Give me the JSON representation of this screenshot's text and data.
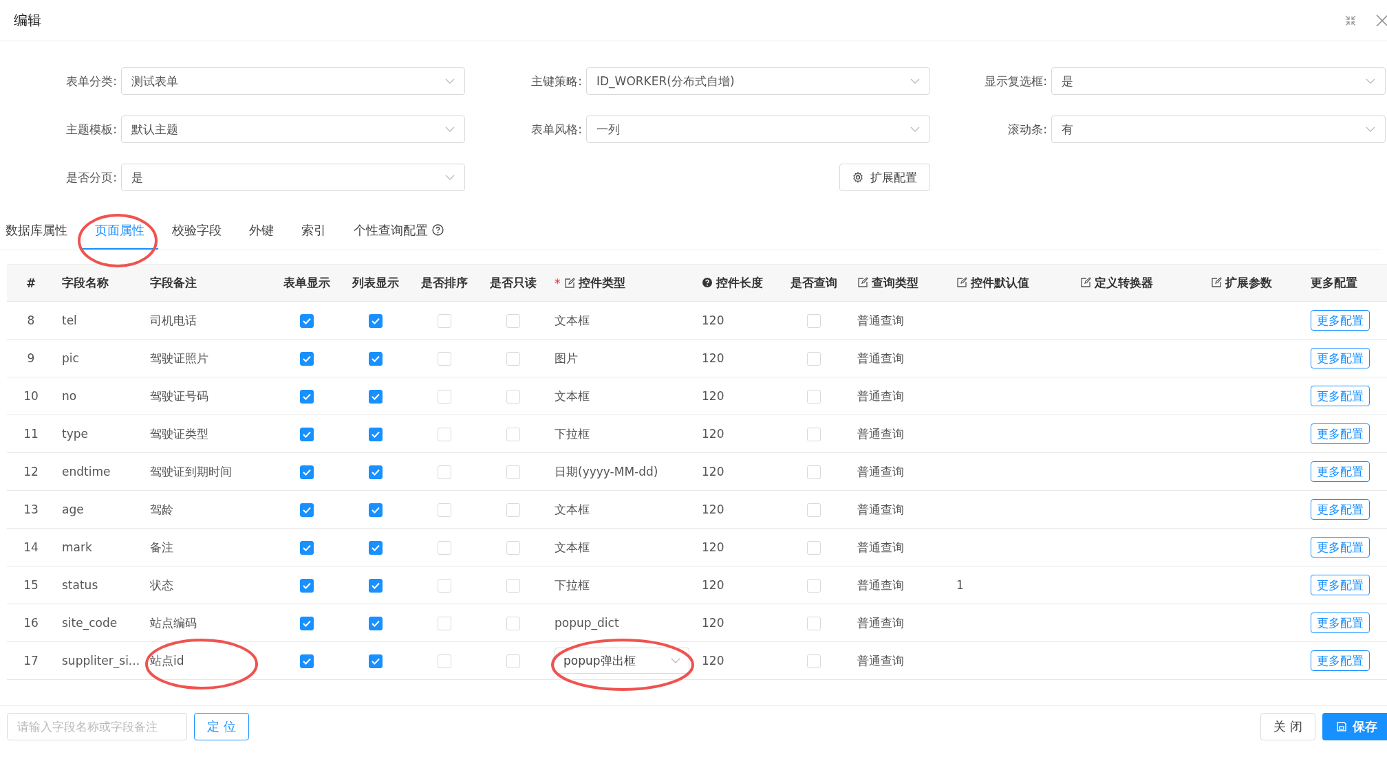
{
  "window": {
    "title": "编辑"
  },
  "form_fields": [
    {
      "label": "表单分类:",
      "value": "测试表单"
    },
    {
      "label": "主键策略:",
      "value": "ID_WORKER(分布式自增)"
    },
    {
      "label": "显示复选框:",
      "value": "是"
    },
    {
      "label": "主题模板:",
      "value": "默认主题"
    },
    {
      "label": "表单风格:",
      "value": "一列"
    },
    {
      "label": "滚动条:",
      "value": "有"
    },
    {
      "label": "是否分页:",
      "value": "是"
    }
  ],
  "extension_button": "扩展配置",
  "tabs": [
    {
      "label": "数据库属性",
      "selected": false
    },
    {
      "label": "页面属性",
      "selected": true
    },
    {
      "label": "校验字段",
      "selected": false
    },
    {
      "label": "外键",
      "selected": false
    },
    {
      "label": "索引",
      "selected": false
    },
    {
      "label": "个性查询配置",
      "selected": false,
      "help": true
    }
  ],
  "table": {
    "columns": [
      {
        "label": "#"
      },
      {
        "label": "字段名称"
      },
      {
        "label": "字段备注"
      },
      {
        "label": "表单显示"
      },
      {
        "label": "列表显示"
      },
      {
        "label": "是否排序"
      },
      {
        "label": "是否只读"
      },
      {
        "label": "控件类型",
        "required_mark": "*",
        "kind": "editable"
      },
      {
        "label": "控件长度",
        "kind": "help"
      },
      {
        "label": "是否查询"
      },
      {
        "label": "查询类型",
        "kind": "editable"
      },
      {
        "label": "控件默认值",
        "kind": "editable"
      },
      {
        "label": "定义转换器",
        "kind": "editable"
      },
      {
        "label": "扩展参数",
        "kind": "editable"
      },
      {
        "label": "更多配置"
      }
    ],
    "rows": [
      {
        "index": "8",
        "name": "tel",
        "note": "司机电话",
        "form_show": true,
        "list_show": true,
        "sortable": false,
        "readonly": false,
        "control_type": {
          "kind": "text",
          "value": "文本框"
        },
        "length": "120",
        "query": false,
        "query_type": "普通查询",
        "action": "更多配置"
      },
      {
        "index": "9",
        "name": "pic",
        "note": "驾驶证照片",
        "form_show": true,
        "list_show": true,
        "sortable": false,
        "readonly": false,
        "control_type": {
          "kind": "text",
          "value": "图片"
        },
        "length": "120",
        "query": false,
        "query_type": "普通查询",
        "action": "更多配置"
      },
      {
        "index": "10",
        "name": "no",
        "note": "驾驶证号码",
        "form_show": true,
        "list_show": true,
        "sortable": false,
        "readonly": false,
        "control_type": {
          "kind": "text",
          "value": "文本框"
        },
        "length": "120",
        "query": false,
        "query_type": "普通查询",
        "action": "更多配置"
      },
      {
        "index": "11",
        "name": "type",
        "note": "驾驶证类型",
        "form_show": true,
        "list_show": true,
        "sortable": false,
        "readonly": false,
        "control_type": {
          "kind": "text",
          "value": "下拉框"
        },
        "length": "120",
        "query": false,
        "query_type": "普通查询",
        "action": "更多配置"
      },
      {
        "index": "12",
        "name": "endtime",
        "note": "驾驶证到期时间",
        "form_show": true,
        "list_show": true,
        "sortable": false,
        "readonly": false,
        "control_type": {
          "kind": "text",
          "value": "日期(yyyy-MM-dd)"
        },
        "length": "120",
        "query": false,
        "query_type": "普通查询",
        "action": "更多配置"
      },
      {
        "index": "13",
        "name": "age",
        "note": "驾龄",
        "form_show": true,
        "list_show": true,
        "sortable": false,
        "readonly": false,
        "control_type": {
          "kind": "text",
          "value": "文本框"
        },
        "length": "120",
        "query": false,
        "query_type": "普通查询",
        "action": "更多配置"
      },
      {
        "index": "14",
        "name": "mark",
        "note": "备注",
        "form_show": true,
        "list_show": true,
        "sortable": false,
        "readonly": false,
        "control_type": {
          "kind": "text",
          "value": "文本框"
        },
        "length": "120",
        "query": false,
        "query_type": "普通查询",
        "action": "更多配置"
      },
      {
        "index": "15",
        "name": "status",
        "note": "状态",
        "form_show": true,
        "list_show": true,
        "sortable": false,
        "readonly": false,
        "control_type": {
          "kind": "text",
          "value": "下拉框"
        },
        "length": "120",
        "query": false,
        "query_type": "普通查询",
        "default_value": "1",
        "action": "更多配置"
      },
      {
        "index": "16",
        "name": "site_code",
        "note": "站点编码",
        "form_show": true,
        "list_show": true,
        "sortable": false,
        "readonly": false,
        "control_type": {
          "kind": "text",
          "value": "popup_dict"
        },
        "length": "120",
        "query": false,
        "query_type": "普通查询",
        "action": "更多配置"
      },
      {
        "index": "17",
        "name": "suppliter_si...",
        "note": "站点id",
        "form_show": true,
        "list_show": true,
        "sortable": false,
        "readonly": false,
        "control_type": {
          "kind": "select",
          "value": "popup弹出框"
        },
        "length": "120",
        "query": false,
        "query_type": "普通查询",
        "action": "更多配置"
      }
    ]
  },
  "footer": {
    "search": {
      "placeholder": "请输入字段名称或字段备注"
    },
    "locate_button": "定 位",
    "close_button": "关 闭",
    "save_button": "保存"
  }
}
